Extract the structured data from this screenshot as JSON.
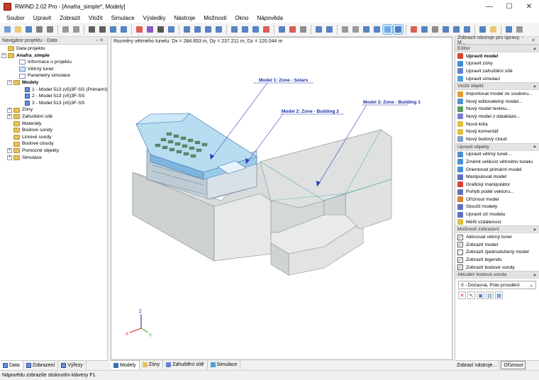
{
  "window": {
    "title": "RWIND 2.02 Pro - [Anafra_simple*, Modely]",
    "minimize": "—",
    "maximize": "☐",
    "close": "✕"
  },
  "menu": [
    "Soubor",
    "Upravit",
    "Zobrazit",
    "Vložit",
    "Simulace",
    "Výsledky",
    "Nástroje",
    "Možnosti",
    "Okno",
    "Nápověda"
  ],
  "navigator": {
    "header": "Navigátor projektu - Data",
    "items": [
      {
        "label": "Data projektu",
        "level": 0,
        "icon": "folder",
        "expander": ""
      },
      {
        "label": "Anafra_simple",
        "level": 0,
        "icon": "folder",
        "expander": "−",
        "bold": true
      },
      {
        "label": "Informace o projektu",
        "level": 2,
        "icon": "doc",
        "expander": ""
      },
      {
        "label": "Větrný tunel",
        "level": 2,
        "icon": "wind",
        "expander": ""
      },
      {
        "label": "Parametry simulace",
        "level": 2,
        "icon": "doc",
        "expander": ""
      },
      {
        "label": "Modely",
        "level": 1,
        "icon": "folder",
        "expander": "−",
        "bold": true
      },
      {
        "label": "1 - Model 513 (v5)3F-SS (Primární)",
        "level": 3,
        "icon": "model",
        "expander": ""
      },
      {
        "label": "2 - Model 513 (v5)3F-SS",
        "level": 3,
        "icon": "model",
        "expander": ""
      },
      {
        "label": "3 - Model 513 (v5)3F-SS",
        "level": 3,
        "icon": "model",
        "expander": ""
      },
      {
        "label": "Zóny",
        "level": 1,
        "icon": "folder",
        "expander": "+"
      },
      {
        "label": "Zahuštění sítě",
        "level": 1,
        "icon": "folder",
        "expander": "+"
      },
      {
        "label": "Materiály",
        "level": 1,
        "icon": "folder",
        "expander": ""
      },
      {
        "label": "Bodové sondy",
        "level": 1,
        "icon": "folder",
        "expander": ""
      },
      {
        "label": "Liniové sondy",
        "level": 1,
        "icon": "folder",
        "expander": ""
      },
      {
        "label": "Bodové cloudy",
        "level": 1,
        "icon": "folder",
        "expander": ""
      },
      {
        "label": "Pomocné objekty",
        "level": 1,
        "icon": "folder",
        "expander": "+"
      },
      {
        "label": "Simulace",
        "level": 1,
        "icon": "folder",
        "expander": "+"
      }
    ],
    "tabs": [
      "Data",
      "Zobrazení",
      "Výřezy"
    ]
  },
  "viewport": {
    "info": "Rozměry větrného tunelu: Dx = 284.653 m, Dy = 237.211 m, Dz = 120.044 m",
    "labels": [
      "Model 1: Zone - Solars",
      "Model 2: Zone - Building 2",
      "Model 3: Zone - Building 1"
    ],
    "axes": {
      "x": "X",
      "y": "Y",
      "z": "Z"
    },
    "tabs": [
      "Modely",
      "Zóny",
      "Zahuštění sítě",
      "Simulace"
    ]
  },
  "tools": {
    "header": "Zobrazit nástroje pro úpravy. - M...",
    "sections": [
      {
        "title": "Editor",
        "items": [
          {
            "label": "Upravit model",
            "bold": true,
            "color": "#d9423a"
          },
          {
            "label": "Upravit zóny",
            "color": "#3f8fd8"
          },
          {
            "label": "Upravit zahuštění sítě",
            "color": "#6a7fd0"
          },
          {
            "label": "Upravit simulaci",
            "color": "#4aa0e0"
          }
        ]
      },
      {
        "title": "Vložit objekt",
        "items": [
          {
            "label": "Importovat model ze souboru...",
            "color": "#e0a030"
          },
          {
            "label": "Nový editovatelný model...",
            "color": "#5a8fd6"
          },
          {
            "label": "Nový model terénu...",
            "color": "#5aa05a"
          },
          {
            "label": "Nový model z databáze...",
            "color": "#7f7fd0"
          },
          {
            "label": "Nová kóta",
            "color": "#e0c040"
          },
          {
            "label": "Nový komentář",
            "color": "#e0c040"
          },
          {
            "label": "Nový bodový cloud",
            "color": "#7f9fd0"
          }
        ]
      },
      {
        "title": "Upravit objekty",
        "items": [
          {
            "label": "Upravit větrný tunel...",
            "color": "#4a8fd8"
          },
          {
            "label": "Změnit velikost větrného tunelu",
            "color": "#4a8fd8"
          },
          {
            "label": "Orientovat primární model",
            "color": "#4a8fd8"
          },
          {
            "label": "Manipulovat model",
            "color": "#6070c0"
          },
          {
            "label": "Grafický manipulátor",
            "color": "#d9423a"
          },
          {
            "label": "Pohyb podél vektoru...",
            "color": "#6070c0"
          },
          {
            "label": "Oříznout model",
            "color": "#e08030"
          },
          {
            "label": "Sloučit modely",
            "color": "#6070c0"
          },
          {
            "label": "Upravit síť modelu",
            "color": "#6070c0"
          },
          {
            "label": "Měřit vzdálenost",
            "color": "#e0c040"
          }
        ]
      },
      {
        "title": "Možnosti zobrazení",
        "checks": [
          {
            "label": "Aktivovat větrný tunel",
            "checked": true
          },
          {
            "label": "Zobrazit model",
            "checked": true
          },
          {
            "label": "Zobrazit zjednodušený model",
            "checked": false
          },
          {
            "label": "Zobrazit legendu",
            "checked": true
          },
          {
            "label": "Zobrazit bodové sondy",
            "checked": true
          }
        ]
      },
      {
        "title": "Aktuální bodová sonda"
      }
    ],
    "probe_value": "0 - Dočasná, Pole proudění",
    "tabs": [
      "Zobrazí nástroje...",
      "Oříznout"
    ]
  },
  "status": "Nápovědu zobrazíte stisknutím klávesy F1."
}
